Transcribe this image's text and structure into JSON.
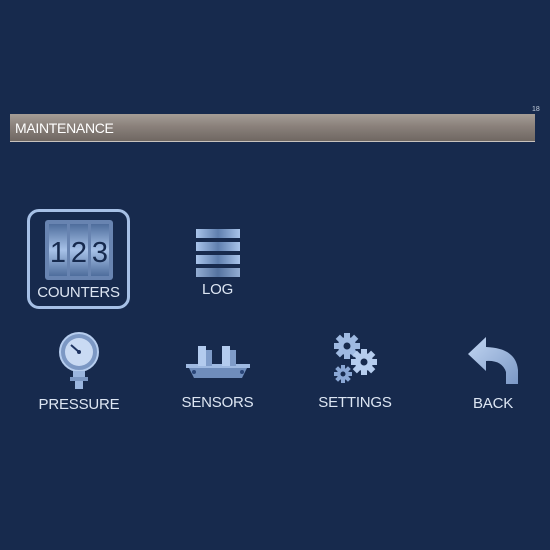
{
  "page_number": "18",
  "header": {
    "title": "MAINTENANCE"
  },
  "menu": {
    "counters": {
      "label": "COUNTERS",
      "digits": [
        "1",
        "2",
        "3"
      ],
      "icon": "counter-icon",
      "selected": true
    },
    "log": {
      "label": "LOG",
      "icon": "log-lines-icon"
    },
    "pressure": {
      "label": "PRESSURE",
      "icon": "pressure-gauge-icon"
    },
    "sensors": {
      "label": "SENSORS",
      "icon": "sensor-icon"
    },
    "settings": {
      "label": "SETTINGS",
      "icon": "gears-icon"
    },
    "back": {
      "label": "BACK",
      "icon": "back-arrow-icon"
    }
  },
  "colors": {
    "background": "#172a4d",
    "title_bar": "#8a817b",
    "icon_light": "#a9c4ea",
    "icon_dark": "#5f7fae",
    "label": "#dde6f3",
    "selection_border": "#a6c0e6"
  }
}
